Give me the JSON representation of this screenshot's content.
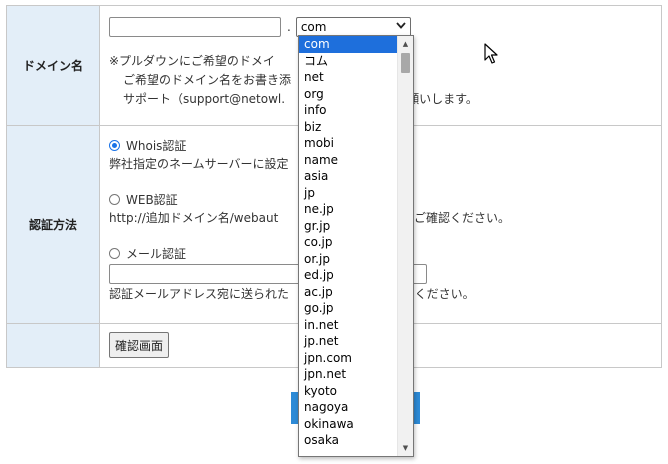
{
  "form": {
    "domain_row": {
      "label": "ドメイン名",
      "name_input": {
        "value": "",
        "placeholder": ""
      },
      "separator": ".",
      "tld_select": {
        "selected": "com"
      },
      "notes": [
        "※プルダウンにご希望のドメイ",
        "ご希望のドメイン名をお書き添",
        "サポート（support@netowl.",
        "願いします。"
      ]
    },
    "auth_row": {
      "label": "認証方法",
      "options": [
        {
          "label": "Whois認証",
          "checked": true,
          "desc": "弊社指定のネームサーバーに設定"
        },
        {
          "label": "WEB認証",
          "checked": false,
          "desc": "http://追加ドメイン名/webaut",
          "desc_tail": "きるかご確認ください。"
        },
        {
          "label": "メール認証",
          "checked": false,
          "desc": "認証メールアドレス宛に送られた",
          "desc_tail": "てください。"
        }
      ],
      "email_input": {
        "value": ""
      }
    },
    "submit": {
      "label": "確認画面"
    }
  },
  "dropdown": {
    "options": [
      "com",
      "コム",
      "net",
      "org",
      "info",
      "biz",
      "mobi",
      "name",
      "asia",
      "jp",
      "ne.jp",
      "gr.jp",
      "co.jp",
      "or.jp",
      "ed.jp",
      "ac.jp",
      "go.jp",
      "in.net",
      "jp.net",
      "jpn.com",
      "jpn.net",
      "kyoto",
      "nagoya",
      "okinawa",
      "osaka"
    ],
    "selected_index": 0
  },
  "colors": {
    "header_bg": "#e3eef8",
    "selected_bg": "#1e6fdc",
    "radio_accent": "#1a73e8",
    "behind_button": "#2d8ad6"
  },
  "icons": {
    "select_chevron": "chevron-down-icon",
    "cursor": "mouse-pointer-icon",
    "scroll_up": "arrow-up-icon",
    "scroll_down": "arrow-down-icon"
  }
}
